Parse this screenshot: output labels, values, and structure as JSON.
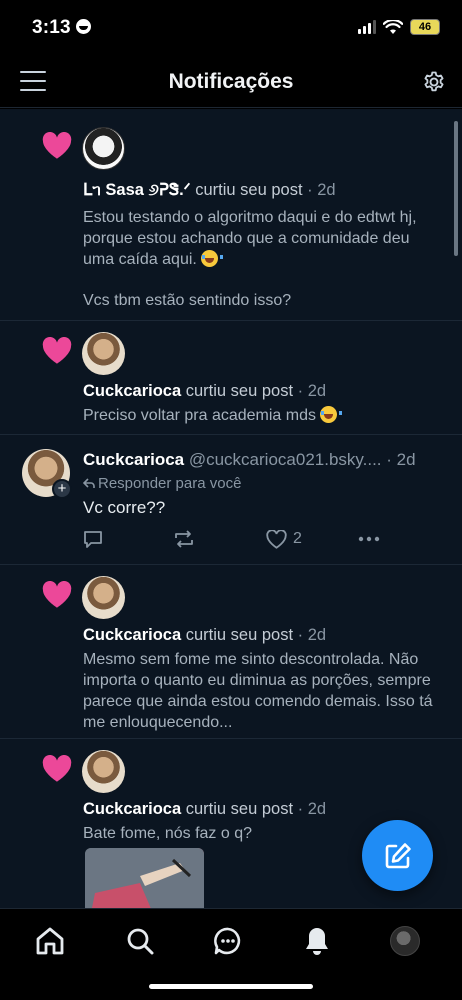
{
  "status_bar": {
    "time": "3:13",
    "battery": "46"
  },
  "header": {
    "title": "Notificações"
  },
  "notifications": [
    {
      "type": "like",
      "user": "ᒪᥐ Sasa ୬ᕈᏕ.ᐟ",
      "action": " curtiu seu post",
      "time": " · 2d",
      "text_1": "Estou testando o algoritmo daqui e do edtwt hj, porque estou achando que a comunidade deu uma caída aqui.",
      "text_2": "Vcs tbm estão sentindo isso?"
    },
    {
      "type": "like",
      "user": "Cuckcarioca",
      "action": " curtiu seu post",
      "time": " · 2d",
      "text_1": "Preciso voltar pra academia mds"
    },
    {
      "type": "reply",
      "user": "Cuckcarioca",
      "handle": " @cuckcarioca021.bsky....",
      "time": " · 2d",
      "reply_to": "Responder para você",
      "text_1": "Vc corre??",
      "like_count": "2"
    },
    {
      "type": "like",
      "user": "Cuckcarioca",
      "action": " curtiu seu post",
      "time": " · 2d",
      "text_1": "Mesmo sem fome me sinto descontrolada. Não importa o quanto eu diminua as porções, sempre parece que ainda estou comendo demais. Isso tá me enlouquecendo..."
    },
    {
      "type": "like",
      "user": "Cuckcarioca",
      "action": " curtiu seu post",
      "time": " · 2d",
      "text_1": "Bate fome, nós faz o q?"
    }
  ],
  "colors": {
    "accent": "#1f8cf5",
    "heart": "#ec4899",
    "feed_bg": "#0b1521"
  },
  "icons": {
    "menu": "hamburger-icon",
    "settings": "gear-icon",
    "like": "heart-icon",
    "compose": "pencil-square-icon",
    "home": "home-icon",
    "search": "search-icon",
    "chat": "chat-icon",
    "notifications": "bell-icon"
  }
}
